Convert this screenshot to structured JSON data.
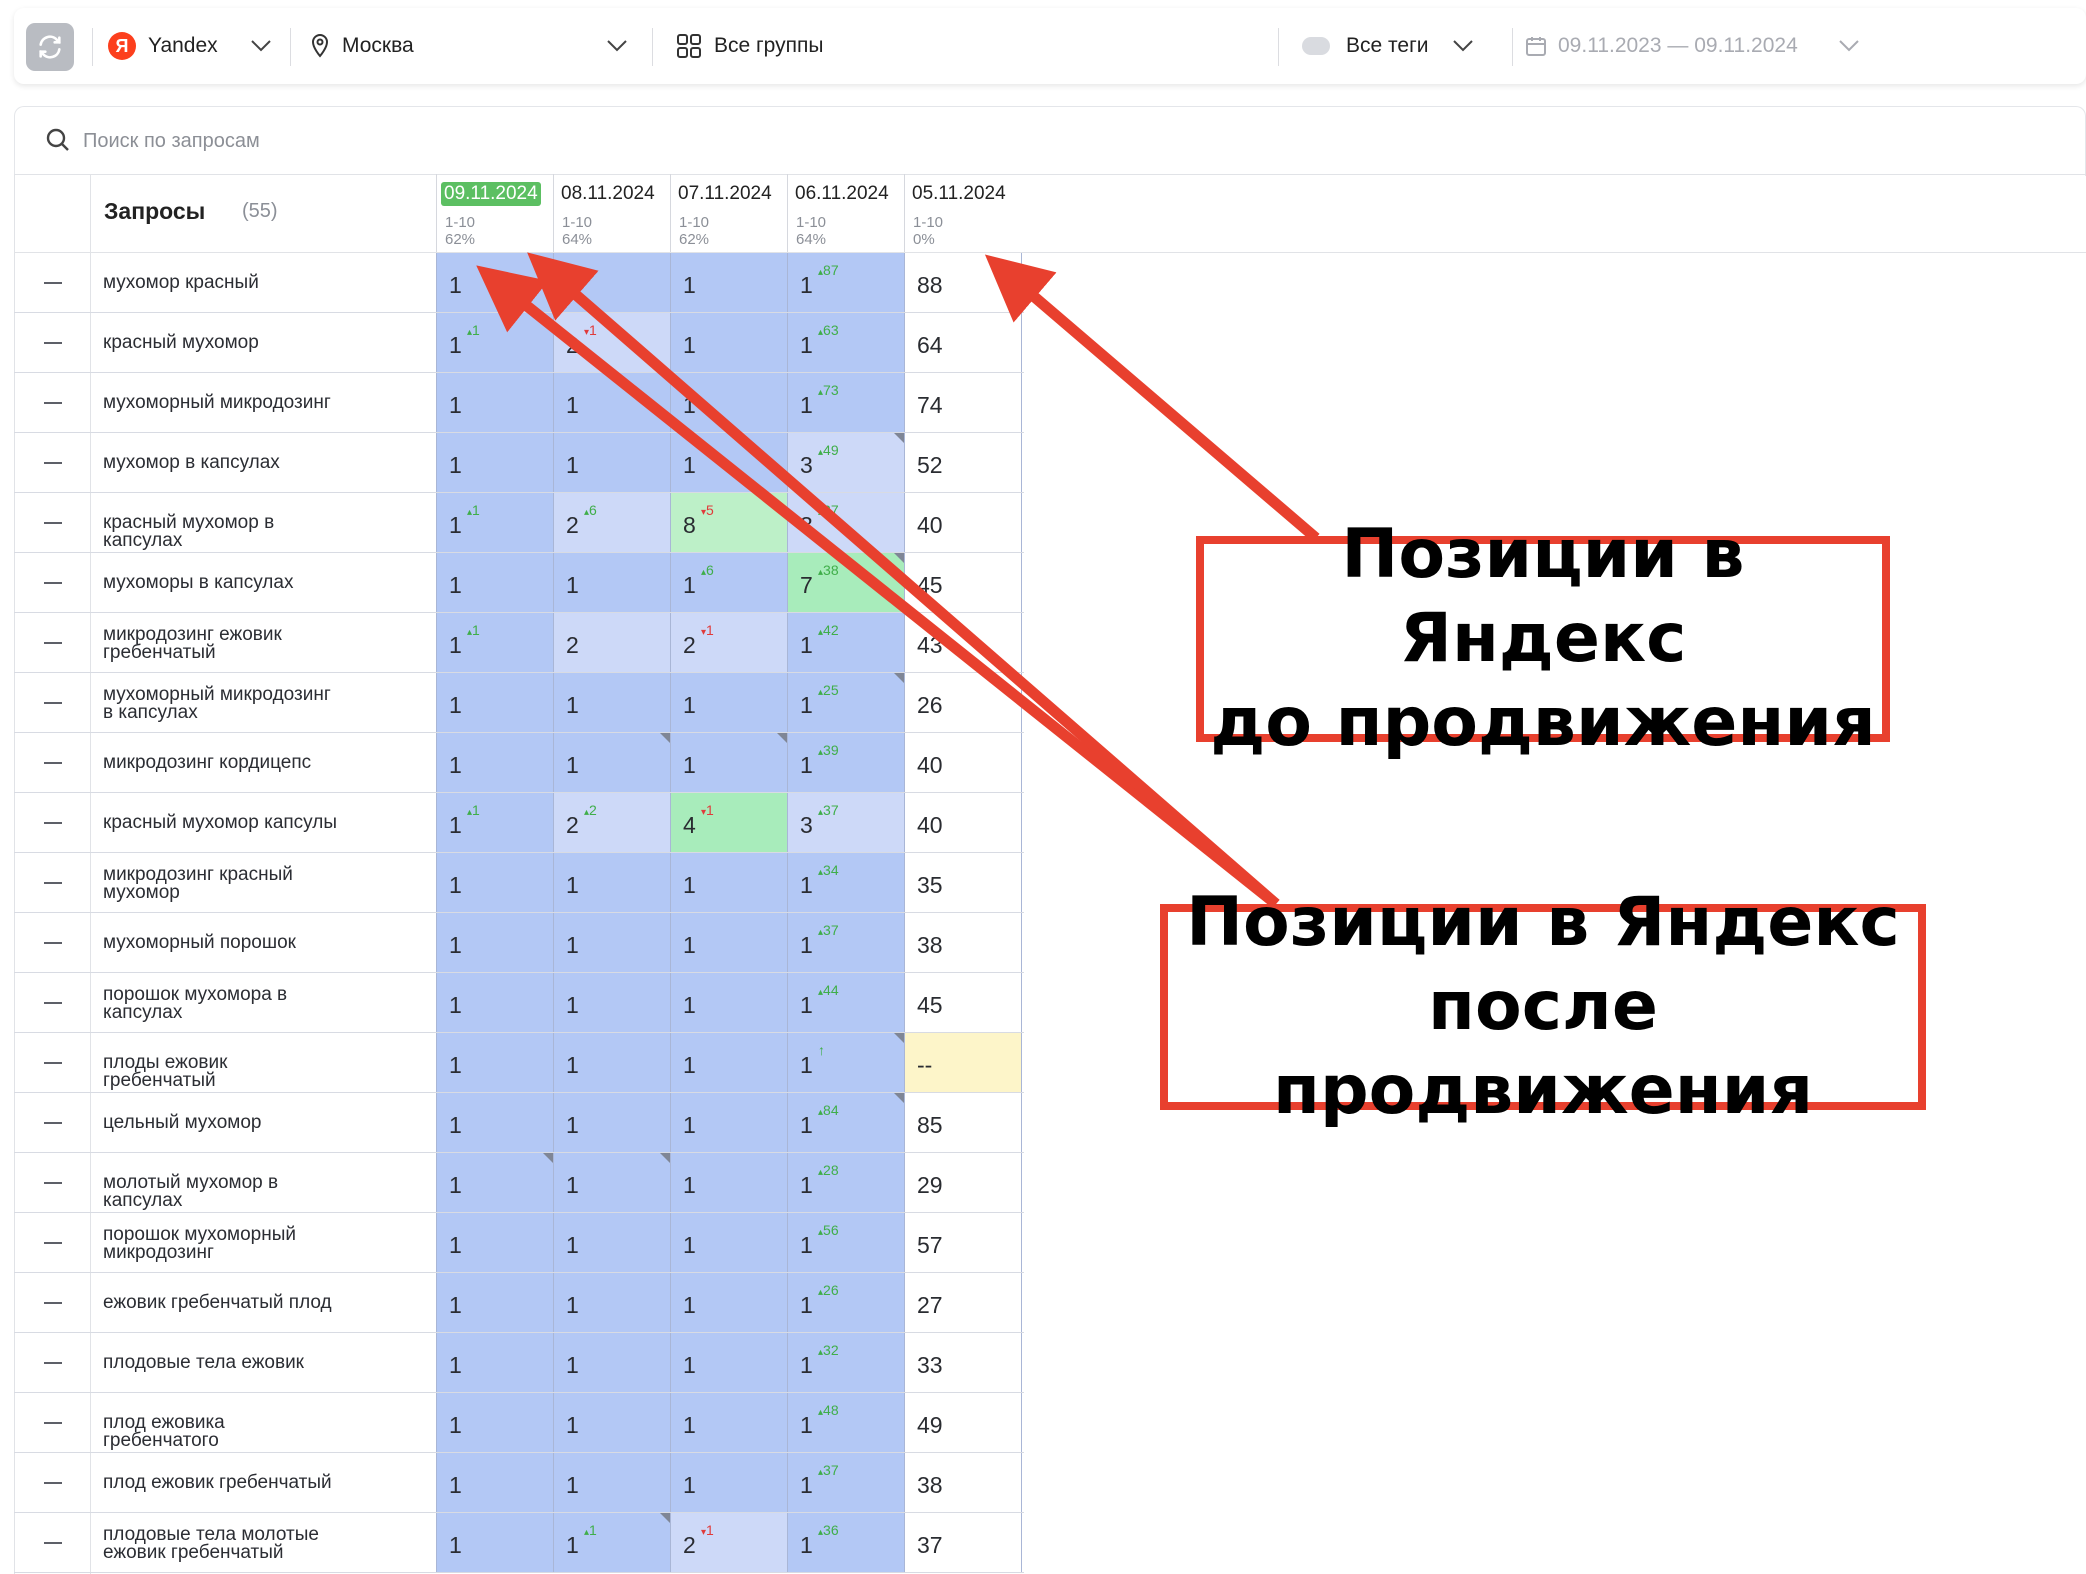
{
  "toolbar": {
    "engine": "Yandex",
    "engine_logo": "Я",
    "region": "Москва",
    "groups": "Все группы",
    "tags": "Все теги",
    "date_range": "09.11.2023 — 09.11.2024"
  },
  "search": {
    "placeholder": "Поиск по запросам"
  },
  "table": {
    "title": "Запросы",
    "count": "(55)",
    "dates": [
      {
        "date": "09.11.2024",
        "range": "1-10",
        "pct": "62%",
        "active": true
      },
      {
        "date": "08.11.2024",
        "range": "1-10",
        "pct": "64%",
        "active": false
      },
      {
        "date": "07.11.2024",
        "range": "1-10",
        "pct": "62%",
        "active": false
      },
      {
        "date": "06.11.2024",
        "range": "1-10",
        "pct": "64%",
        "active": false
      },
      {
        "date": "05.11.2024",
        "range": "1-10",
        "pct": "0%",
        "active": false
      }
    ],
    "rows": [
      {
        "q": "мухомор красный",
        "cells": [
          [
            "1",
            "",
            "",
            "top",
            false
          ],
          [
            "1",
            "",
            "",
            "top",
            false
          ],
          [
            "1",
            "",
            "",
            "top",
            false
          ],
          [
            "1",
            "87",
            "up",
            "top",
            false
          ],
          [
            "88",
            "",
            "",
            "white",
            false
          ]
        ]
      },
      {
        "q": "красный мухомор",
        "cells": [
          [
            "1",
            "1",
            "up",
            "top",
            false
          ],
          [
            "2",
            "1",
            "down",
            "light",
            false
          ],
          [
            "1",
            "",
            "",
            "top",
            false
          ],
          [
            "1",
            "63",
            "up",
            "top",
            false
          ],
          [
            "64",
            "",
            "",
            "white",
            false
          ]
        ]
      },
      {
        "q": "мухоморный микродозинг",
        "cells": [
          [
            "1",
            "",
            "",
            "top",
            false
          ],
          [
            "1",
            "",
            "",
            "top",
            false
          ],
          [
            "1",
            "",
            "",
            "top",
            false
          ],
          [
            "1",
            "73",
            "up",
            "top",
            false
          ],
          [
            "74",
            "",
            "",
            "white",
            false
          ]
        ]
      },
      {
        "q": "мухомор в капсулах",
        "cells": [
          [
            "1",
            "",
            "",
            "top",
            false
          ],
          [
            "1",
            "",
            "",
            "top",
            false
          ],
          [
            "1",
            "",
            "",
            "top",
            false
          ],
          [
            "3",
            "49",
            "up",
            "light",
            true
          ],
          [
            "52",
            "",
            "",
            "white",
            false
          ]
        ]
      },
      {
        "q": "красный мухомор в капсулах",
        "cells": [
          [
            "1",
            "1",
            "up",
            "top",
            false
          ],
          [
            "2",
            "6",
            "up",
            "light",
            false
          ],
          [
            "8",
            "5",
            "down",
            "green",
            false
          ],
          [
            "3",
            "37",
            "up",
            "light",
            false
          ],
          [
            "40",
            "",
            "",
            "white",
            false
          ]
        ]
      },
      {
        "q": "мухоморы в капсулах",
        "cells": [
          [
            "1",
            "",
            "",
            "top",
            false
          ],
          [
            "1",
            "",
            "",
            "top",
            false
          ],
          [
            "1",
            "6",
            "up",
            "top",
            false
          ],
          [
            "7",
            "38",
            "up",
            "green2",
            true
          ],
          [
            "45",
            "",
            "",
            "white",
            false
          ]
        ]
      },
      {
        "q": "микродозинг ежовик гребенчатый",
        "cells": [
          [
            "1",
            "1",
            "up",
            "top",
            false
          ],
          [
            "2",
            "",
            "",
            "light",
            false
          ],
          [
            "2",
            "1",
            "down",
            "light",
            false
          ],
          [
            "1",
            "42",
            "up",
            "top",
            false
          ],
          [
            "43",
            "",
            "",
            "white",
            false
          ]
        ]
      },
      {
        "q": "мухоморный микродозинг в капсулах",
        "cells": [
          [
            "1",
            "",
            "",
            "top",
            false
          ],
          [
            "1",
            "",
            "",
            "top",
            false
          ],
          [
            "1",
            "",
            "",
            "top",
            false
          ],
          [
            "1",
            "25",
            "up",
            "top",
            true
          ],
          [
            "26",
            "",
            "",
            "white",
            false
          ]
        ]
      },
      {
        "q": "микродозинг кордицепс",
        "cells": [
          [
            "1",
            "",
            "",
            "top",
            false
          ],
          [
            "1",
            "",
            "",
            "top",
            true
          ],
          [
            "1",
            "",
            "",
            "top",
            true
          ],
          [
            "1",
            "39",
            "up",
            "top",
            false
          ],
          [
            "40",
            "",
            "",
            "white",
            false
          ]
        ]
      },
      {
        "q": "красный мухомор капсулы",
        "cells": [
          [
            "1",
            "1",
            "up",
            "top",
            false
          ],
          [
            "2",
            "2",
            "up",
            "light",
            false
          ],
          [
            "4",
            "1",
            "down",
            "green2",
            false
          ],
          [
            "3",
            "37",
            "up",
            "light",
            false
          ],
          [
            "40",
            "",
            "",
            "white",
            false
          ]
        ]
      },
      {
        "q": "микродозинг красный мухомор",
        "cells": [
          [
            "1",
            "",
            "",
            "top",
            false
          ],
          [
            "1",
            "",
            "",
            "top",
            false
          ],
          [
            "1",
            "",
            "",
            "top",
            false
          ],
          [
            "1",
            "34",
            "up",
            "top",
            false
          ],
          [
            "35",
            "",
            "",
            "white",
            false
          ]
        ]
      },
      {
        "q": "мухоморный порошок",
        "cells": [
          [
            "1",
            "",
            "",
            "top",
            false
          ],
          [
            "1",
            "",
            "",
            "top",
            false
          ],
          [
            "1",
            "",
            "",
            "top",
            false
          ],
          [
            "1",
            "37",
            "up",
            "top",
            false
          ],
          [
            "38",
            "",
            "",
            "white",
            false
          ]
        ]
      },
      {
        "q": "порошок мухомора в капсулах",
        "cells": [
          [
            "1",
            "",
            "",
            "top",
            false
          ],
          [
            "1",
            "",
            "",
            "top",
            false
          ],
          [
            "1",
            "",
            "",
            "top",
            false
          ],
          [
            "1",
            "44",
            "up",
            "top",
            false
          ],
          [
            "45",
            "",
            "",
            "white",
            false
          ]
        ]
      },
      {
        "q": "плоды ежовик гребенчатый",
        "cells": [
          [
            "1",
            "",
            "",
            "top",
            false
          ],
          [
            "1",
            "",
            "",
            "top",
            false
          ],
          [
            "1",
            "",
            "",
            "top",
            false
          ],
          [
            "1",
            "↑",
            "up",
            "top",
            true
          ],
          [
            "--",
            "",
            "",
            "yellow",
            false
          ]
        ]
      },
      {
        "q": "цельный мухомор",
        "cells": [
          [
            "1",
            "",
            "",
            "top",
            false
          ],
          [
            "1",
            "",
            "",
            "top",
            false
          ],
          [
            "1",
            "",
            "",
            "top",
            false
          ],
          [
            "1",
            "84",
            "up",
            "top",
            true
          ],
          [
            "85",
            "",
            "",
            "white",
            false
          ]
        ]
      },
      {
        "q": "молотый мухомор в капсулах",
        "cells": [
          [
            "1",
            "",
            "",
            "top",
            true
          ],
          [
            "1",
            "",
            "",
            "top",
            true
          ],
          [
            "1",
            "",
            "",
            "top",
            false
          ],
          [
            "1",
            "28",
            "up",
            "top",
            false
          ],
          [
            "29",
            "",
            "",
            "white",
            false
          ]
        ]
      },
      {
        "q": "порошок мухоморный микродозинг",
        "cells": [
          [
            "1",
            "",
            "",
            "top",
            false
          ],
          [
            "1",
            "",
            "",
            "top",
            false
          ],
          [
            "1",
            "",
            "",
            "top",
            false
          ],
          [
            "1",
            "56",
            "up",
            "top",
            false
          ],
          [
            "57",
            "",
            "",
            "white",
            false
          ]
        ]
      },
      {
        "q": "ежовик гребенчатый плод",
        "cells": [
          [
            "1",
            "",
            "",
            "top",
            false
          ],
          [
            "1",
            "",
            "",
            "top",
            false
          ],
          [
            "1",
            "",
            "",
            "top",
            false
          ],
          [
            "1",
            "26",
            "up",
            "top",
            false
          ],
          [
            "27",
            "",
            "",
            "white",
            false
          ]
        ]
      },
      {
        "q": "плодовые тела ежовик",
        "cells": [
          [
            "1",
            "",
            "",
            "top",
            false
          ],
          [
            "1",
            "",
            "",
            "top",
            false
          ],
          [
            "1",
            "",
            "",
            "top",
            false
          ],
          [
            "1",
            "32",
            "up",
            "top",
            false
          ],
          [
            "33",
            "",
            "",
            "white",
            false
          ]
        ]
      },
      {
        "q": "плод ежовика гребенчатого",
        "cells": [
          [
            "1",
            "",
            "",
            "top",
            false
          ],
          [
            "1",
            "",
            "",
            "top",
            false
          ],
          [
            "1",
            "",
            "",
            "top",
            false
          ],
          [
            "1",
            "48",
            "up",
            "top",
            false
          ],
          [
            "49",
            "",
            "",
            "white",
            false
          ]
        ]
      },
      {
        "q": "плод ежовик гребенчатый",
        "cells": [
          [
            "1",
            "",
            "",
            "top",
            false
          ],
          [
            "1",
            "",
            "",
            "top",
            false
          ],
          [
            "1",
            "",
            "",
            "top",
            false
          ],
          [
            "1",
            "37",
            "up",
            "top",
            false
          ],
          [
            "38",
            "",
            "",
            "white",
            false
          ]
        ]
      },
      {
        "q": "плодовые тела молотые ежовик гребенчатый",
        "cells": [
          [
            "1",
            "",
            "",
            "top",
            false
          ],
          [
            "1",
            "1",
            "up",
            "top",
            true
          ],
          [
            "2",
            "1",
            "down",
            "light",
            false
          ],
          [
            "1",
            "36",
            "up",
            "top",
            false
          ],
          [
            "37",
            "",
            "",
            "white",
            false
          ]
        ]
      }
    ]
  },
  "annotations": {
    "before": {
      "line1": "Позиции в Яндекс",
      "line2": "до продвижения"
    },
    "after": {
      "line1": "Позиции в Яндекс",
      "line2": "после продвижения"
    }
  },
  "colors": {
    "accent_red": "#e8402e",
    "active_date": "#5cbf62",
    "cell_top": "#b3c8f5"
  }
}
